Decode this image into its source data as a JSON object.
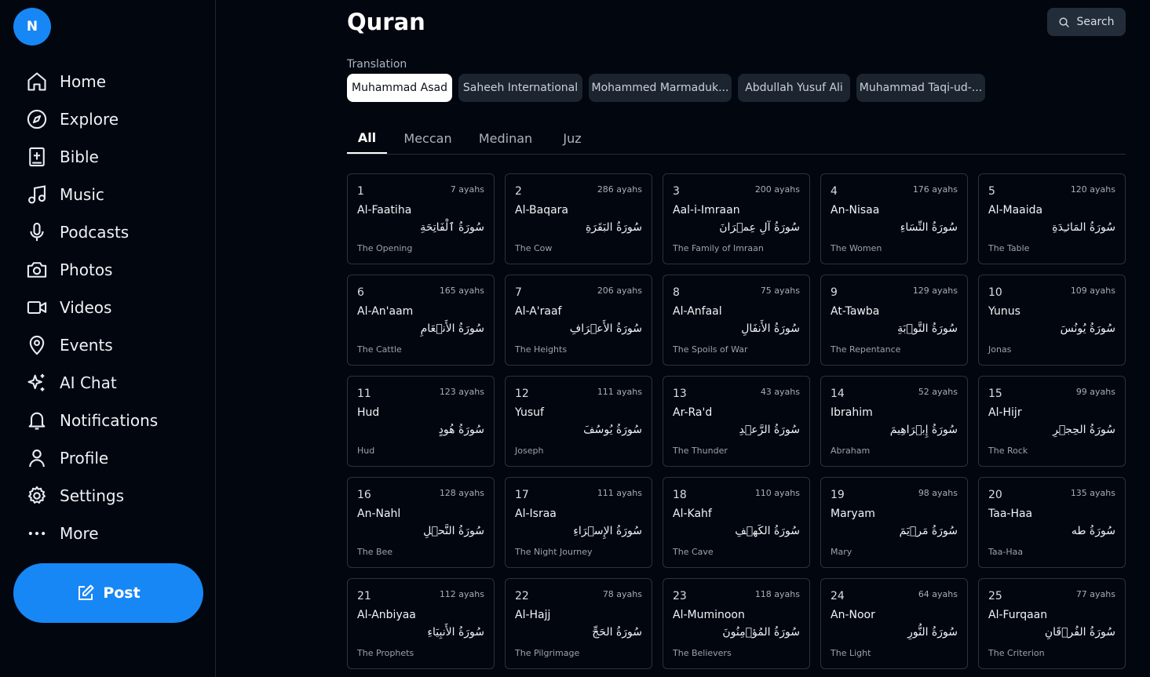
{
  "user": {
    "avatar_initial": "N"
  },
  "nav": [
    {
      "label": "Home",
      "icon": "home-icon"
    },
    {
      "label": "Explore",
      "icon": "compass-icon"
    },
    {
      "label": "Bible",
      "icon": "bible-icon"
    },
    {
      "label": "Music",
      "icon": "music-icon"
    },
    {
      "label": "Podcasts",
      "icon": "microphone-icon"
    },
    {
      "label": "Photos",
      "icon": "camera-icon"
    },
    {
      "label": "Videos",
      "icon": "video-icon"
    },
    {
      "label": "Events",
      "icon": "map-pin-icon"
    },
    {
      "label": "AI Chat",
      "icon": "sparkles-icon"
    },
    {
      "label": "Notifications",
      "icon": "bell-icon"
    },
    {
      "label": "Profile",
      "icon": "user-icon"
    },
    {
      "label": "Settings",
      "icon": "gear-icon"
    },
    {
      "label": "More",
      "icon": "more-dots-icon"
    }
  ],
  "post_label": "Post",
  "page": {
    "title": "Quran",
    "search_label": "Search"
  },
  "translation": {
    "label": "Translation",
    "options": [
      "Muhammad Asad",
      "Saheeh International",
      "Mohammed Marmaduk...",
      "Abdullah Yusuf Ali",
      "Muhammad Taqi-ud-..."
    ],
    "selected": "Muhammad Asad"
  },
  "tabs": [
    "All",
    "Meccan",
    "Medinan",
    "Juz"
  ],
  "active_tab": "All",
  "surahs": [
    {
      "num": "1",
      "name": "Al-Faatiha",
      "arabic": "سُورَةُ ٱلْفَاتِحَةِ",
      "english": "The Opening",
      "ayahs": "7 ayahs"
    },
    {
      "num": "2",
      "name": "Al-Baqara",
      "arabic": "سُورَةُ البَقَرَةِ",
      "english": "The Cow",
      "ayahs": "286 ayahs"
    },
    {
      "num": "3",
      "name": "Aal-i-Imraan",
      "arabic": "سُورَةُ آلِ عِمۡرَانَ",
      "english": "The Family of Imraan",
      "ayahs": "200 ayahs"
    },
    {
      "num": "4",
      "name": "An-Nisaa",
      "arabic": "سُورَةُ النِّسَاءِ",
      "english": "The Women",
      "ayahs": "176 ayahs"
    },
    {
      "num": "5",
      "name": "Al-Maaida",
      "arabic": "سُورَةُ المَائـِدَةِ",
      "english": "The Table",
      "ayahs": "120 ayahs"
    },
    {
      "num": "6",
      "name": "Al-An'aam",
      "arabic": "سُورَةُ الأَنۡعَامِ",
      "english": "The Cattle",
      "ayahs": "165 ayahs"
    },
    {
      "num": "7",
      "name": "Al-A'raaf",
      "arabic": "سُورَةُ الأَعۡرَافِ",
      "english": "The Heights",
      "ayahs": "206 ayahs"
    },
    {
      "num": "8",
      "name": "Al-Anfaal",
      "arabic": "سُورَةُ الأَنفَالِ",
      "english": "The Spoils of War",
      "ayahs": "75 ayahs"
    },
    {
      "num": "9",
      "name": "At-Tawba",
      "arabic": "سُورَةُ التَّوۡبَةِ",
      "english": "The Repentance",
      "ayahs": "129 ayahs"
    },
    {
      "num": "10",
      "name": "Yunus",
      "arabic": "سُورَةُ يُونُسَ",
      "english": "Jonas",
      "ayahs": "109 ayahs"
    },
    {
      "num": "11",
      "name": "Hud",
      "arabic": "سُورَةُ هُودٍ",
      "english": "Hud",
      "ayahs": "123 ayahs"
    },
    {
      "num": "12",
      "name": "Yusuf",
      "arabic": "سُورَةُ يُوسُفَ",
      "english": "Joseph",
      "ayahs": "111 ayahs"
    },
    {
      "num": "13",
      "name": "Ar-Ra'd",
      "arabic": "سُورَةُ الرَّعۡدِ",
      "english": "The Thunder",
      "ayahs": "43 ayahs"
    },
    {
      "num": "14",
      "name": "Ibrahim",
      "arabic": "سُورَةُ إِبۡرَاهِيمَ",
      "english": "Abraham",
      "ayahs": "52 ayahs"
    },
    {
      "num": "15",
      "name": "Al-Hijr",
      "arabic": "سُورَةُ الحِجۡرِ",
      "english": "The Rock",
      "ayahs": "99 ayahs"
    },
    {
      "num": "16",
      "name": "An-Nahl",
      "arabic": "سُورَةُ النَّحۡلِ",
      "english": "The Bee",
      "ayahs": "128 ayahs"
    },
    {
      "num": "17",
      "name": "Al-Israa",
      "arabic": "سُورَةُ الإِسۡرَاءِ",
      "english": "The Night Journey",
      "ayahs": "111 ayahs"
    },
    {
      "num": "18",
      "name": "Al-Kahf",
      "arabic": "سُورَةُ الكَهۡفِ",
      "english": "The Cave",
      "ayahs": "110 ayahs"
    },
    {
      "num": "19",
      "name": "Maryam",
      "arabic": "سُورَةُ مَرۡيَمَ",
      "english": "Mary",
      "ayahs": "98 ayahs"
    },
    {
      "num": "20",
      "name": "Taa-Haa",
      "arabic": "سُورَةُ طه",
      "english": "Taa-Haa",
      "ayahs": "135 ayahs"
    },
    {
      "num": "21",
      "name": "Al-Anbiyaa",
      "arabic": "سُورَةُ الأَنبِيَاءِ",
      "english": "The Prophets",
      "ayahs": "112 ayahs"
    },
    {
      "num": "22",
      "name": "Al-Hajj",
      "arabic": "سُورَةُ الحَجِّ",
      "english": "The Pilgrimage",
      "ayahs": "78 ayahs"
    },
    {
      "num": "23",
      "name": "Al-Muminoon",
      "arabic": "سُورَةُ المُؤۡمِنُونَ",
      "english": "The Believers",
      "ayahs": "118 ayahs"
    },
    {
      "num": "24",
      "name": "An-Noor",
      "arabic": "سُورَةُ النُّورِ",
      "english": "The Light",
      "ayahs": "64 ayahs"
    },
    {
      "num": "25",
      "name": "Al-Furqaan",
      "arabic": "سُورَةُ الفُرۡقَانِ",
      "english": "The Criterion",
      "ayahs": "77 ayahs"
    }
  ]
}
